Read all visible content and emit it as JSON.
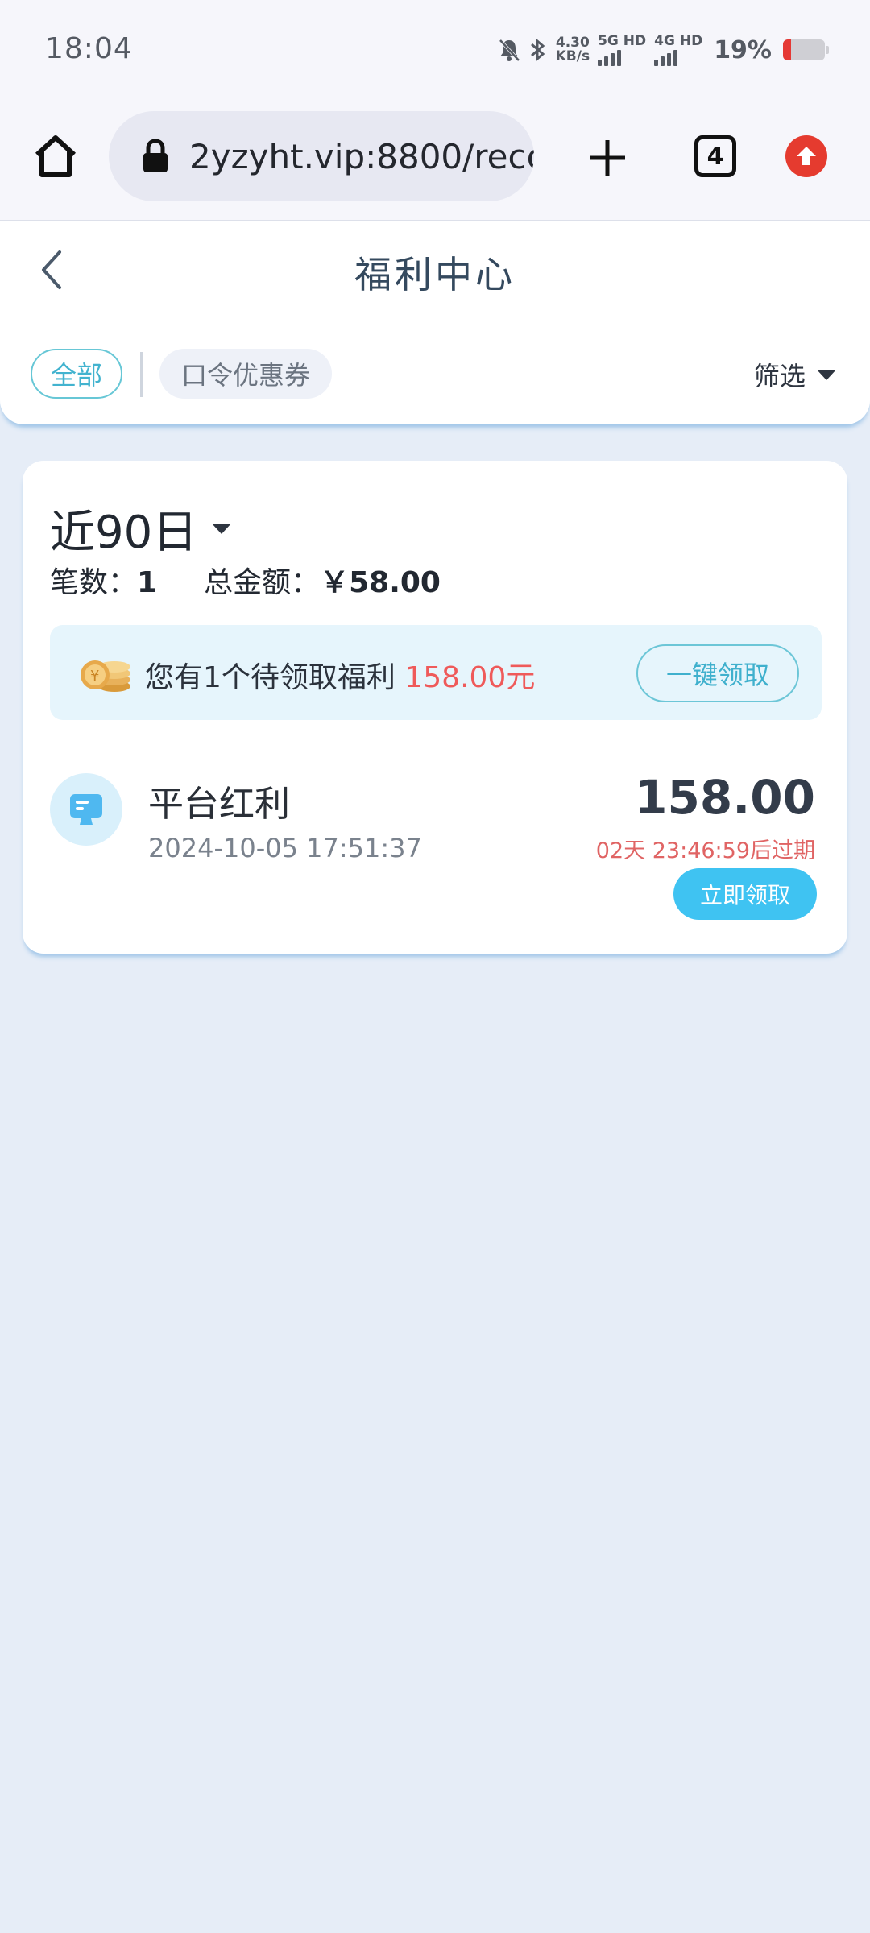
{
  "status_bar": {
    "time": "18:04",
    "net_speed_value": "4.30",
    "net_speed_unit": "KB/s",
    "sim1_label": "5G HD",
    "sim2_label": "4G HD",
    "battery_percent": "19%",
    "icons": [
      "mute-bell-icon",
      "bluetooth-icon",
      "signal-icon",
      "battery-icon"
    ]
  },
  "browser": {
    "url": "2yzyht.vip:8800/reco",
    "tab_count": "4",
    "icons": [
      "home-icon",
      "lock-icon",
      "plus-icon",
      "tabs-icon",
      "update-arrow-icon"
    ]
  },
  "header": {
    "title": "福利中心",
    "chips": [
      {
        "label": "全部",
        "selected": true
      },
      {
        "label": "口令优惠券",
        "selected": false
      }
    ],
    "filter_label": "筛选",
    "accent_color": "#42b3cf"
  },
  "summary": {
    "period": "近90日",
    "count_label": "笔数：",
    "count_value": "1",
    "total_label": "总金额：",
    "total_value": "￥58.00"
  },
  "pending": {
    "text": "您有1个待领取福利",
    "amount": "158.00元",
    "claim_all_label": "一键领取",
    "amount_color": "#ef5a5a"
  },
  "records": [
    {
      "title": "平台红利",
      "date": "2024-10-05 17:51:37",
      "amount": "158.00",
      "expire_text": "02天 23:46:59后过期",
      "action_label": "立即领取",
      "icon": "monitor-icon"
    }
  ]
}
